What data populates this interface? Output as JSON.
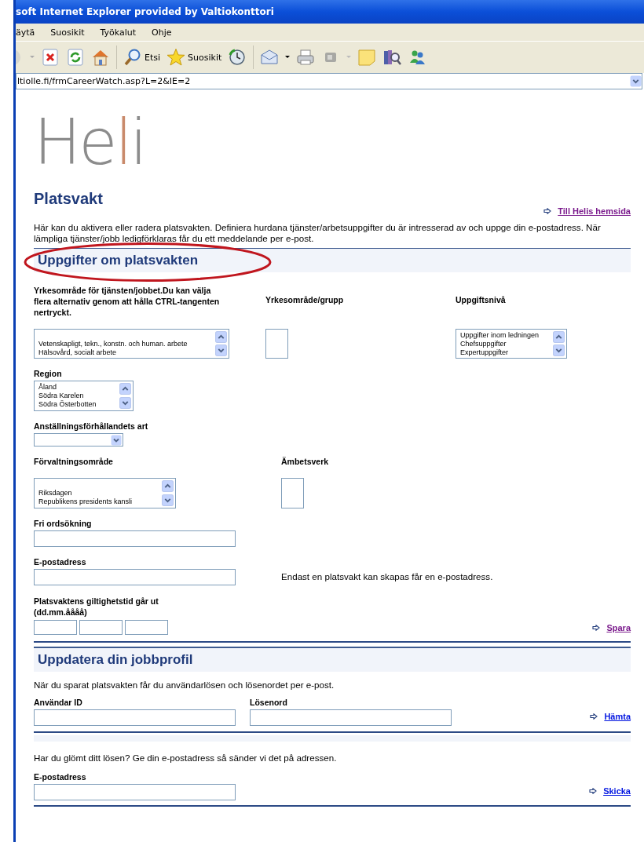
{
  "window": {
    "title": "soft Internet Explorer provided by Valtiokonttori"
  },
  "menu": [
    "äytä",
    "Suosikit",
    "Työkalut",
    "Ohje"
  ],
  "toolbar": {
    "search_label": "Etsi",
    "favorites_label": "Suosikit"
  },
  "address": {
    "value": "ltiolle.fi/frmCareerWatch.asp?L=2&IE=2"
  },
  "logo": "Heli",
  "page": {
    "title": "Platsvakt",
    "home_link": {
      "text": "Till Helis hemsida",
      "visited": true
    },
    "intro": "Här kan du aktivera eller radera platsvakten. Definiera hurdana tjänster/arbetsuppgifter du är intresserad av och uppge din e-postadress. När lämpliga tjänster/jobb ledigförklaras får du ett meddelande per e-post."
  },
  "watch": {
    "heading": "Uppgifter om platsvakten",
    "occupation": {
      "label": "Yrkesområde för tjänsten/jobbet.Du kan välja flera alternativ genom att hålla CTRL-tangenten nertryckt.",
      "options": [
        "Vetenskapligt, tekn., konstn. och human. arbete",
        "Hälsovård, socialt arbete"
      ]
    },
    "group": {
      "label": "Yrkesområde/grupp"
    },
    "task_level": {
      "label": "Uppgiftsnivå",
      "options": [
        "Uppgifter inom ledningen",
        "Chefsuppgifter",
        "Expertuppgifter"
      ]
    },
    "region": {
      "label": "Region",
      "options": [
        "Åland",
        "Södra Karelen",
        "Södra Österbotten"
      ]
    },
    "employment": {
      "label": "Anställningsförhållandets art"
    },
    "administration": {
      "label": "Förvaltningsområde",
      "options": [
        "Riksdagen",
        "Republikens presidents kansli"
      ]
    },
    "agency": {
      "label": "Ämbetsverk"
    },
    "keyword": {
      "label": "Fri ordsökning"
    },
    "email": {
      "label": "E-postadress",
      "note": "Endast en platsvakt kan skapas får en e-postadress."
    },
    "expiry": {
      "label": "Platsvaktens giltighetstid går ut (dd.mm.åååå)"
    },
    "save_link": {
      "text": "Spara",
      "visited": true
    }
  },
  "profile": {
    "heading": "Uppdatera din jobbprofil",
    "intro": "När du sparat platsvakten får du användarlösen och lösenordet per e-post.",
    "user_label": "Användar ID",
    "password_label": "Lösenord",
    "fetch_link": {
      "text": "Hämta",
      "visited": false
    },
    "forgot_text": "Har du glömt ditt lösen? Ge din e-postadress så sänder vi det på adressen.",
    "email_label": "E-postadress",
    "send_link": {
      "text": "Skicka",
      "visited": false
    }
  }
}
